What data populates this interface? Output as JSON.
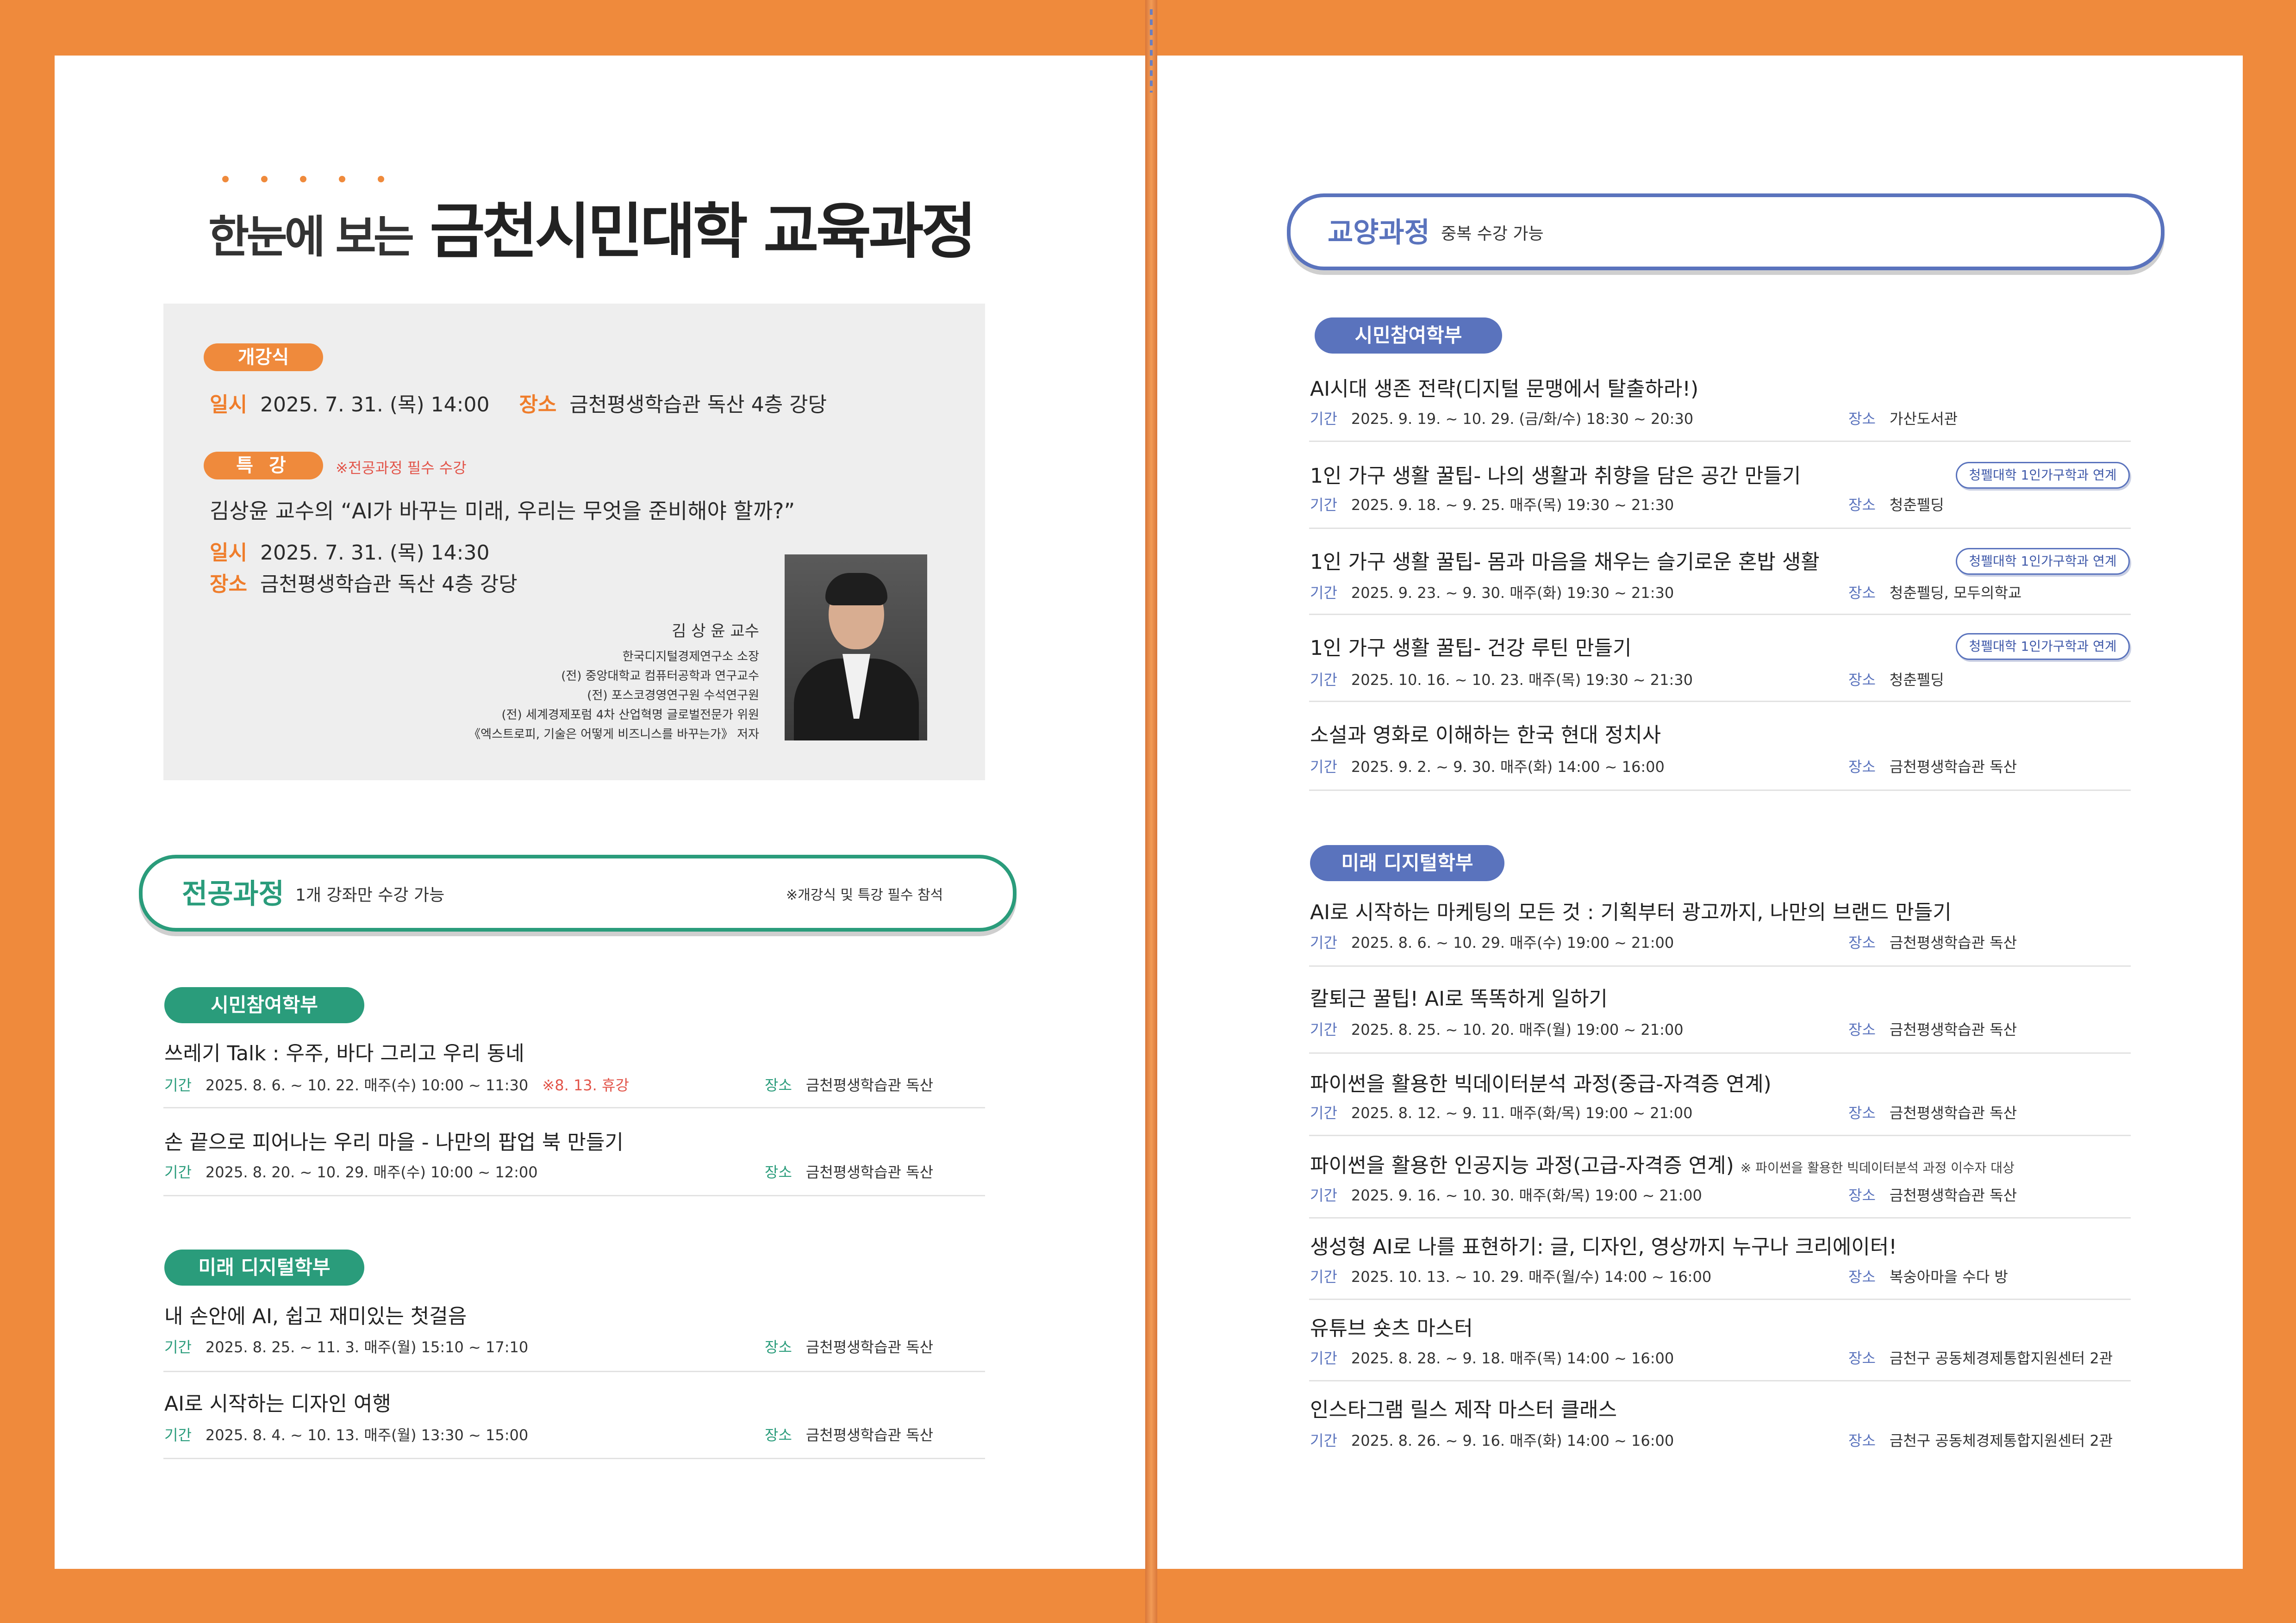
{
  "colors": {
    "frame": "#ef8a3c",
    "green": "#2a9c7b",
    "blue": "#5a73bd",
    "note_red": "#e2554a"
  },
  "headline": {
    "part1": "한눈에 보는",
    "part2": "금천시민대학 교육과정"
  },
  "opening": {
    "badge": "개강식",
    "date_label": "일시",
    "date": "2025. 7. 31. (목) 14:00",
    "place_label": "장소",
    "place": "금천평생학습관 독산 4층 강당"
  },
  "special": {
    "badge": "특 강",
    "note": "※전공과정 필수 수강",
    "title": "김상윤 교수의 “AI가 바꾸는 미래, 우리는 무엇을 준비해야 할까?”",
    "date_label": "일시",
    "date": "2025. 7. 31. (목) 14:30",
    "place_label": "장소",
    "place": "금천평생학습관 독산 4층 강당",
    "photo_icon": "speaker-portrait",
    "speaker_name": "김 상 윤  교수",
    "bio": [
      "한국디지털경제연구소 소장",
      "(전) 중앙대학교 컴퓨터공학과 연구교수",
      "(전) 포스코경영연구원 수석연구원",
      "(전) 세계경제포럼 4차 산업혁명 글로벌전문가 위원",
      "《엑스트로피, 기술은 어떻게 비즈니스를 바꾸는가》 저자"
    ]
  },
  "major": {
    "title": "전공과정",
    "subtitle": "1개 강좌만 수강 가능",
    "note": "※개강식 및 특강 필수 참석",
    "period_label": "기간",
    "place_label": "장소",
    "departments": [
      {
        "name": "시민참여학부",
        "courses": [
          {
            "title": "쓰레기 Talk : 우주, 바다 그리고 우리 동네",
            "period": "2025. 8. 6. ~ 10. 22. 매주(수) 10:00 ~ 11:30",
            "note": "※8. 13. 휴강",
            "place": "금천평생학습관 독산"
          },
          {
            "title": "손 끝으로 피어나는 우리 마을 - 나만의 팝업 북 만들기",
            "period": "2025. 8. 20. ~ 10. 29. 매주(수) 10:00 ~ 12:00",
            "place": "금천평생학습관 독산"
          }
        ]
      },
      {
        "name": "미래 디지털학부",
        "courses": [
          {
            "title": "내 손안에 AI, 쉽고 재미있는 첫걸음",
            "period": "2025. 8. 25. ~ 11. 3. 매주(월) 15:10 ~ 17:10",
            "place": "금천평생학습관 독산"
          },
          {
            "title": "AI로 시작하는 디자인 여행",
            "period": "2025. 8. 4. ~ 10. 13. 매주(월) 13:30 ~ 15:00",
            "place": "금천평생학습관 독산"
          }
        ]
      }
    ]
  },
  "liberal": {
    "title": "교양과정",
    "subtitle": "중복 수강 가능",
    "period_label": "기간",
    "place_label": "장소",
    "departments": [
      {
        "name": "시민참여학부",
        "courses": [
          {
            "title": "AI시대 생존 전략(디지털 문맹에서 탈출하라!)",
            "period": "2025. 9. 19. ~ 10. 29. (금/화/수) 18:30 ~ 20:30",
            "place": "가산도서관"
          },
          {
            "title": "1인 가구 생활 꿀팁- 나의 생활과 취향을 담은 공간 만들기",
            "period": "2025. 9. 18. ~ 9. 25. 매주(목) 19:30 ~ 21:30",
            "place": "청춘펠딩",
            "badge": "청펠대학 1인가구학과 연계"
          },
          {
            "title": "1인 가구 생활 꿀팁- 몸과 마음을 채우는 슬기로운 혼밥 생활",
            "period": "2025. 9. 23. ~ 9. 30. 매주(화) 19:30 ~ 21:30",
            "place": "청춘펠딩, 모두의학교",
            "badge": "청펠대학 1인가구학과 연계"
          },
          {
            "title": "1인 가구 생활 꿀팁- 건강 루틴 만들기",
            "period": "2025. 10. 16. ~ 10. 23. 매주(목) 19:30 ~ 21:30",
            "place": "청춘펠딩",
            "badge": "청펠대학 1인가구학과 연계"
          },
          {
            "title": "소설과 영화로 이해하는 한국 현대 정치사",
            "period": "2025. 9. 2. ~ 9. 30. 매주(화) 14:00 ~ 16:00",
            "place": "금천평생학습관 독산"
          }
        ]
      },
      {
        "name": "미래 디지털학부",
        "courses": [
          {
            "title": "AI로 시작하는 마케팅의 모든 것 : 기획부터 광고까지, 나만의 브랜드 만들기",
            "period": "2025. 8. 6. ~ 10. 29. 매주(수) 19:00 ~ 21:00",
            "place": "금천평생학습관 독산"
          },
          {
            "title": "칼퇴근 꿀팁! AI로 똑똑하게 일하기",
            "period": "2025. 8. 25. ~ 10. 20. 매주(월) 19:00 ~ 21:00",
            "place": "금천평생학습관 독산"
          },
          {
            "title": "파이썬을 활용한 빅데이터분석 과정(중급-자격증 연계)",
            "period": "2025. 8. 12. ~ 9. 11. 매주(화/목) 19:00 ~ 21:00",
            "place": "금천평생학습관 독산"
          },
          {
            "title": "파이썬을 활용한 인공지능 과정(고급-자격증 연계)",
            "title_note": "※ 파이썬을 활용한 빅데이터분석 과정 이수자 대상",
            "period": "2025. 9. 16. ~ 10. 30. 매주(화/목) 19:00 ~ 21:00",
            "place": "금천평생학습관 독산"
          },
          {
            "title": "생성형 AI로 나를 표현하기: 글, 디자인, 영상까지 누구나 크리에이터!",
            "period": "2025. 10. 13. ~ 10. 29. 매주(월/수) 14:00 ~ 16:00",
            "place": "복숭아마을 수다 방"
          },
          {
            "title": "유튜브 숏츠 마스터",
            "period": "2025. 8. 28. ~ 9. 18. 매주(목) 14:00 ~ 16:00",
            "place": "금천구 공동체경제통합지원센터 2관"
          },
          {
            "title": "인스타그램 릴스 제작 마스터 클래스",
            "period": "2025. 8. 26. ~ 9. 16. 매주(화) 14:00 ~ 16:00",
            "place": "금천구 공동체경제통합지원센터 2관"
          }
        ]
      }
    ]
  }
}
